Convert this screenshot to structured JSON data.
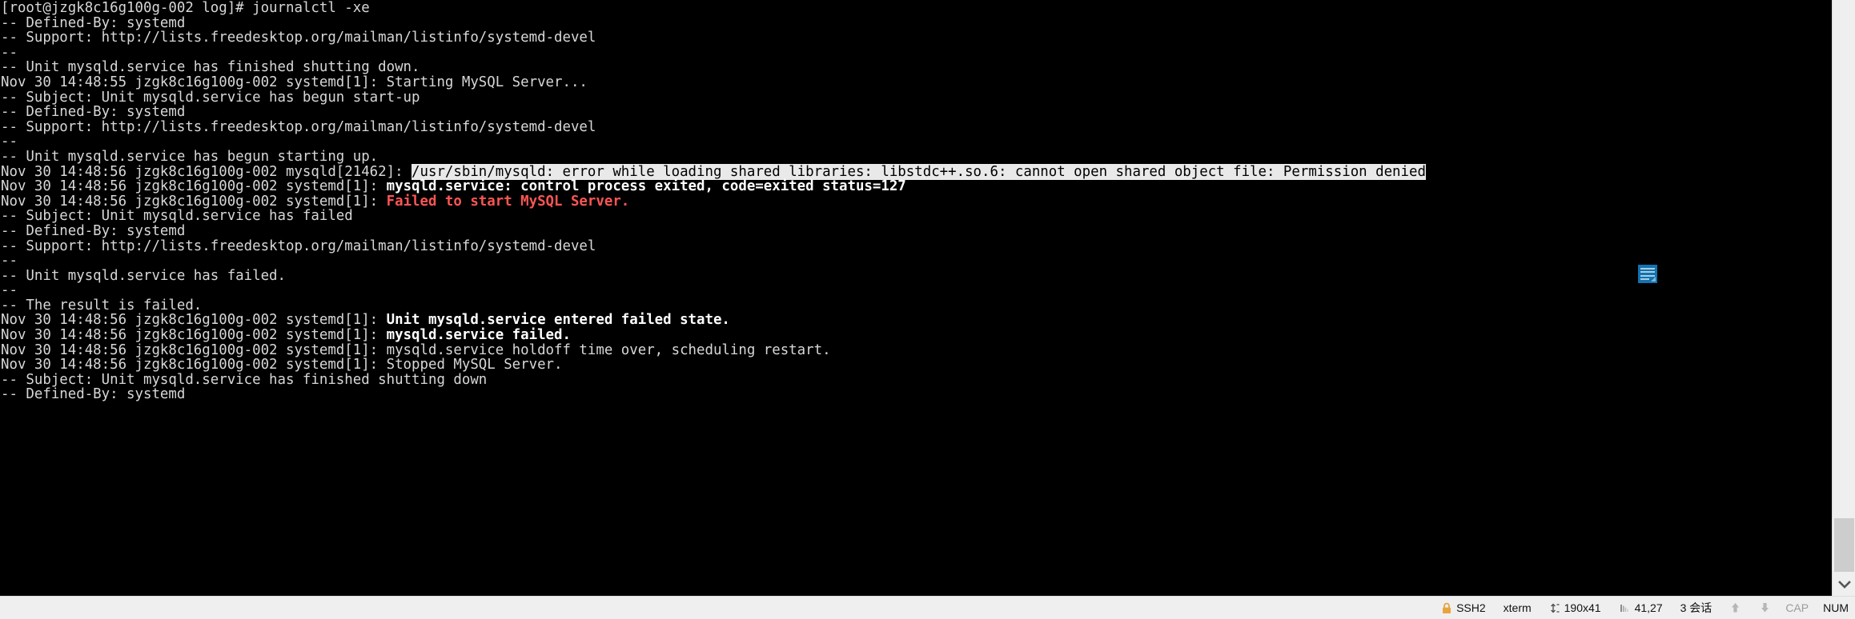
{
  "terminal": {
    "prompt_line": "[root@jzgk8c16g100g-002 log]# journalctl -xe",
    "lines": [
      {
        "id": "l0",
        "segments": [
          {
            "text": "[root@jzgk8c16g100g-002 log]# journalctl -xe",
            "style": "plain"
          }
        ]
      },
      {
        "id": "l1",
        "segments": [
          {
            "text": "-- Defined-By: systemd",
            "style": "plain"
          }
        ]
      },
      {
        "id": "l2",
        "segments": [
          {
            "text": "-- Support: http://lists.freedesktop.org/mailman/listinfo/systemd-devel",
            "style": "plain"
          }
        ]
      },
      {
        "id": "l3",
        "segments": [
          {
            "text": "--",
            "style": "plain"
          }
        ]
      },
      {
        "id": "l4",
        "segments": [
          {
            "text": "-- Unit mysqld.service has finished shutting down.",
            "style": "plain"
          }
        ]
      },
      {
        "id": "l5",
        "segments": [
          {
            "text": "Nov 30 14:48:55 jzgk8c16g100g-002 systemd[1]: Starting MySQL Server...",
            "style": "plain"
          }
        ]
      },
      {
        "id": "l6",
        "segments": [
          {
            "text": "-- Subject: Unit mysqld.service has begun start-up",
            "style": "plain"
          }
        ]
      },
      {
        "id": "l7",
        "segments": [
          {
            "text": "-- Defined-By: systemd",
            "style": "plain"
          }
        ]
      },
      {
        "id": "l8",
        "segments": [
          {
            "text": "-- Support: http://lists.freedesktop.org/mailman/listinfo/systemd-devel",
            "style": "plain"
          }
        ]
      },
      {
        "id": "l9",
        "segments": [
          {
            "text": "--",
            "style": "plain"
          }
        ]
      },
      {
        "id": "l10",
        "segments": [
          {
            "text": "-- Unit mysqld.service has begun starting up.",
            "style": "plain"
          }
        ]
      },
      {
        "id": "l11",
        "segments": [
          {
            "text": "Nov 30 14:48:56 jzgk8c16g100g-002 mysqld[21462]: ",
            "style": "plain"
          },
          {
            "text": "/usr/sbin/mysqld: error while loading shared libraries: libstdc++.so.6: cannot open shared object file: Permission denied",
            "style": "hl"
          }
        ]
      },
      {
        "id": "l12",
        "segments": [
          {
            "text": "Nov 30 14:48:56 jzgk8c16g100g-002 systemd[1]: ",
            "style": "plain"
          },
          {
            "text": "mysqld.service: control process exited, code=exited status=127",
            "style": "bold"
          }
        ]
      },
      {
        "id": "l13",
        "segments": [
          {
            "text": "Nov 30 14:48:56 jzgk8c16g100g-002 systemd[1]: ",
            "style": "plain"
          },
          {
            "text": "Failed to start MySQL Server.",
            "style": "red"
          }
        ]
      },
      {
        "id": "l14",
        "segments": [
          {
            "text": "-- Subject: Unit mysqld.service has failed",
            "style": "plain"
          }
        ]
      },
      {
        "id": "l15",
        "segments": [
          {
            "text": "-- Defined-By: systemd",
            "style": "plain"
          }
        ]
      },
      {
        "id": "l16",
        "segments": [
          {
            "text": "-- Support: http://lists.freedesktop.org/mailman/listinfo/systemd-devel",
            "style": "plain"
          }
        ]
      },
      {
        "id": "l17",
        "segments": [
          {
            "text": "--",
            "style": "plain"
          }
        ]
      },
      {
        "id": "l18",
        "segments": [
          {
            "text": "-- Unit mysqld.service has failed.",
            "style": "plain"
          }
        ]
      },
      {
        "id": "l19",
        "segments": [
          {
            "text": "--",
            "style": "plain"
          }
        ]
      },
      {
        "id": "l20",
        "segments": [
          {
            "text": "-- The result is failed.",
            "style": "plain"
          }
        ]
      },
      {
        "id": "l21",
        "segments": [
          {
            "text": "Nov 30 14:48:56 jzgk8c16g100g-002 systemd[1]: ",
            "style": "plain"
          },
          {
            "text": "Unit mysqld.service entered failed state.",
            "style": "bold"
          }
        ]
      },
      {
        "id": "l22",
        "segments": [
          {
            "text": "Nov 30 14:48:56 jzgk8c16g100g-002 systemd[1]: ",
            "style": "plain"
          },
          {
            "text": "mysqld.service failed.",
            "style": "bold"
          }
        ]
      },
      {
        "id": "l23",
        "segments": [
          {
            "text": "Nov 30 14:48:56 jzgk8c16g100g-002 systemd[1]: mysqld.service holdoff time over, scheduling restart.",
            "style": "plain"
          }
        ]
      },
      {
        "id": "l24",
        "segments": [
          {
            "text": "Nov 30 14:48:56 jzgk8c16g100g-002 systemd[1]: Stopped MySQL Server.",
            "style": "plain"
          }
        ]
      },
      {
        "id": "l25",
        "segments": [
          {
            "text": "-- Subject: Unit mysqld.service has finished shutting down",
            "style": "plain"
          }
        ]
      },
      {
        "id": "l26",
        "segments": [
          {
            "text": "-- Defined-By: systemd",
            "style": "plain"
          }
        ]
      }
    ]
  },
  "overlay": {
    "paste_icon_name": "paste-lines-icon"
  },
  "scrollbar": {
    "down_icon": "chevron-down-icon"
  },
  "statusbar": {
    "lock_icon": "lock-icon",
    "protocol": "SSH2",
    "emulation": "xterm",
    "size_icon": "resize-icon",
    "size": "190x41",
    "cursor_icon": "cursor-position-icon",
    "cursor": "41,27",
    "sessions": "3 会话",
    "upload_icon": "arrow-up-icon",
    "download_icon": "arrow-down-icon",
    "caps": "CAP",
    "num": "NUM"
  },
  "colors": {
    "terminal_bg": "#000000",
    "terminal_fg": "#d7d7d7",
    "highlight_bg": "#e9e9e9",
    "highlight_fg": "#000000",
    "error_red": "#fc5555",
    "chrome_bg": "#efefef",
    "accent_blue": "#1372b0",
    "lock_orange": "#e8a33d"
  }
}
